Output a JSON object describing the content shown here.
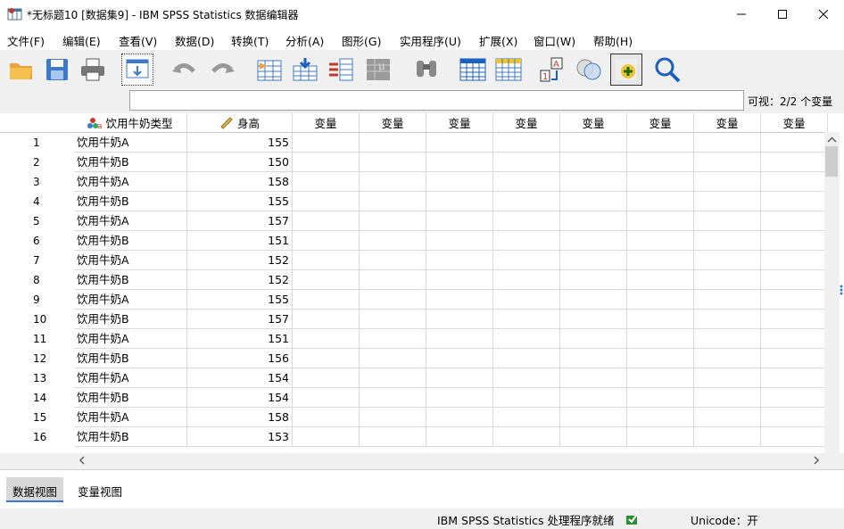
{
  "window": {
    "title": "*无标题10 [数据集9] - IBM SPSS Statistics 数据编辑器"
  },
  "menu": [
    {
      "label": "文件(F)"
    },
    {
      "label": "编辑(E)"
    },
    {
      "label": "查看(V)"
    },
    {
      "label": "数据(D)"
    },
    {
      "label": "转换(T)"
    },
    {
      "label": "分析(A)"
    },
    {
      "label": "图形(G)"
    },
    {
      "label": "实用程序(U)"
    },
    {
      "label": "扩展(X)"
    },
    {
      "label": "窗口(W)"
    },
    {
      "label": "帮助(H)"
    }
  ],
  "toolbar": {
    "icons": [
      "open-folder-icon",
      "save-icon",
      "print-icon",
      "recall-dialog-icon",
      "undo-icon",
      "redo-icon",
      "goto-case-icon",
      "goto-variable-icon",
      "variables-icon",
      "descriptive-stats-icon",
      "find-icon",
      "insert-cases-icon",
      "insert-variable-icon",
      "split-file-icon",
      "weight-cases-icon",
      "select-cases-icon",
      "value-labels-icon",
      "use-variable-sets-icon",
      "search-icon"
    ]
  },
  "editbar": {
    "cell_value": "",
    "visible_count": "可视：2/2 个变量"
  },
  "grid": {
    "columns": [
      {
        "label": "饮用牛奶类型",
        "icon": "nominal-string-icon"
      },
      {
        "label": "身高",
        "icon": "scale-ruler-icon"
      },
      {
        "label": "变量"
      },
      {
        "label": "变量"
      },
      {
        "label": "变量"
      },
      {
        "label": "变量"
      },
      {
        "label": "变量"
      },
      {
        "label": "变量"
      },
      {
        "label": "变量"
      },
      {
        "label": "变量"
      }
    ],
    "rows": [
      {
        "n": "1",
        "milk": "饮用牛奶A",
        "height": "155"
      },
      {
        "n": "2",
        "milk": "饮用牛奶B",
        "height": "150"
      },
      {
        "n": "3",
        "milk": "饮用牛奶A",
        "height": "158"
      },
      {
        "n": "4",
        "milk": "饮用牛奶B",
        "height": "155"
      },
      {
        "n": "5",
        "milk": "饮用牛奶A",
        "height": "157"
      },
      {
        "n": "6",
        "milk": "饮用牛奶B",
        "height": "151"
      },
      {
        "n": "7",
        "milk": "饮用牛奶A",
        "height": "152"
      },
      {
        "n": "8",
        "milk": "饮用牛奶B",
        "height": "152"
      },
      {
        "n": "9",
        "milk": "饮用牛奶A",
        "height": "155"
      },
      {
        "n": "10",
        "milk": "饮用牛奶B",
        "height": "157"
      },
      {
        "n": "11",
        "milk": "饮用牛奶A",
        "height": "151"
      },
      {
        "n": "12",
        "milk": "饮用牛奶B",
        "height": "156"
      },
      {
        "n": "13",
        "milk": "饮用牛奶A",
        "height": "154"
      },
      {
        "n": "14",
        "milk": "饮用牛奶B",
        "height": "154"
      },
      {
        "n": "15",
        "milk": "饮用牛奶A",
        "height": "158"
      },
      {
        "n": "16",
        "milk": "饮用牛奶B",
        "height": "153"
      }
    ]
  },
  "tabs": [
    {
      "label": "数据视图",
      "active": true
    },
    {
      "label": "变量视图",
      "active": false
    }
  ],
  "status": {
    "processor": "IBM SPSS Statistics 处理程序就绪",
    "unicode": "Unicode：开"
  },
  "colors": {
    "accent": "#3c78c8",
    "grid_line": "#d9d9d9"
  }
}
